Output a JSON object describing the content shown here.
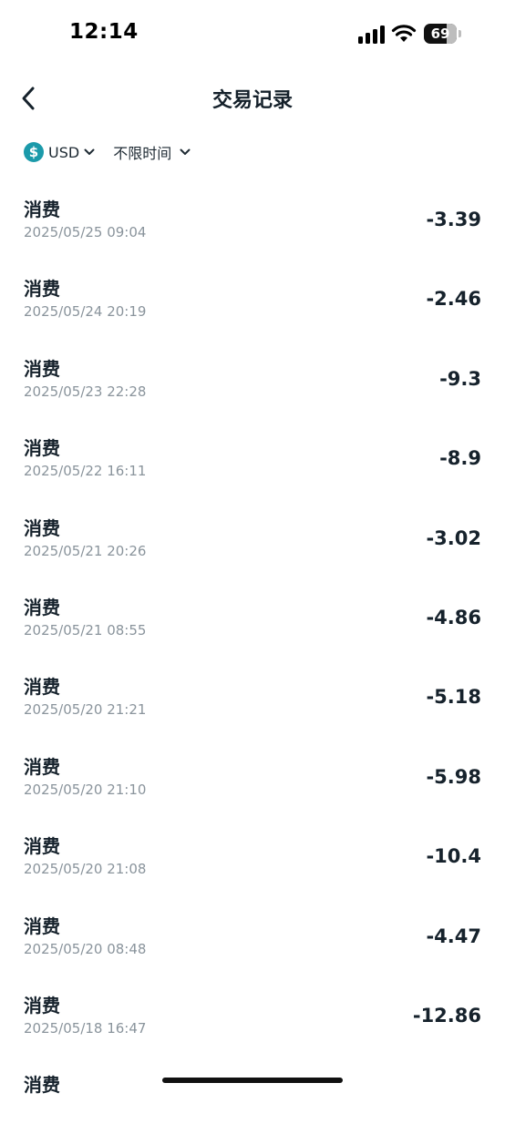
{
  "status_bar": {
    "time": "12:14",
    "battery_level": "69",
    "battery_fraction": 0.69
  },
  "header": {
    "title": "交易记录",
    "back_icon": "chevron-left-icon"
  },
  "filters": {
    "currency_symbol": "$",
    "currency_label": "USD",
    "time_label": "不限时间"
  },
  "transactions": [
    {
      "type": "消费",
      "time": "2025/05/25 09:04",
      "amount": "-3.39"
    },
    {
      "type": "消费",
      "time": "2025/05/24 20:19",
      "amount": "-2.46"
    },
    {
      "type": "消费",
      "time": "2025/05/23 22:28",
      "amount": "-9.3"
    },
    {
      "type": "消费",
      "time": "2025/05/22 16:11",
      "amount": "-8.9"
    },
    {
      "type": "消费",
      "time": "2025/05/21 20:26",
      "amount": "-3.02"
    },
    {
      "type": "消费",
      "time": "2025/05/21 08:55",
      "amount": "-4.86"
    },
    {
      "type": "消费",
      "time": "2025/05/20 21:21",
      "amount": "-5.18"
    },
    {
      "type": "消费",
      "time": "2025/05/20 21:10",
      "amount": "-5.98"
    },
    {
      "type": "消费",
      "time": "2025/05/20 21:08",
      "amount": "-10.4"
    },
    {
      "type": "消费",
      "time": "2025/05/20 08:48",
      "amount": "-4.47"
    },
    {
      "type": "消费",
      "time": "2025/05/18 16:47",
      "amount": "-12.86"
    },
    {
      "type": "消费",
      "time": "",
      "amount": ""
    }
  ],
  "colors": {
    "accent": "#1b9aaa",
    "text_primary": "#16222c",
    "text_secondary": "#8a949c"
  }
}
